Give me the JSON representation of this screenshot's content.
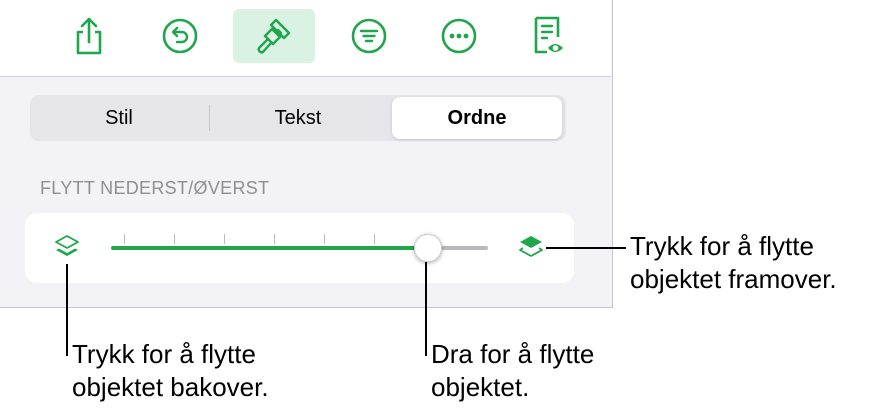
{
  "toolbar": {
    "buttons": [
      {
        "name": "share-icon",
        "active": false
      },
      {
        "name": "undo-icon",
        "active": false
      },
      {
        "name": "paintbrush-icon",
        "active": true
      },
      {
        "name": "filter-icon",
        "active": false
      },
      {
        "name": "more-icon",
        "active": false
      },
      {
        "name": "reader-view-icon",
        "active": false
      }
    ]
  },
  "tabs": {
    "items": [
      "Stil",
      "Tekst",
      "Ordne"
    ],
    "selected": "Ordne"
  },
  "arrange": {
    "section_title": "FLYTT NEDERST/ØVERST",
    "slider": {
      "value_fraction": 0.84,
      "tick_count": 7
    }
  },
  "callouts": {
    "back": {
      "line1": "Trykk for å flytte",
      "line2": "objektet bakover."
    },
    "drag": {
      "line1": "Dra for å flytte",
      "line2": "objektet."
    },
    "forward": {
      "line1": "Trykk for å flytte",
      "line2": "objektet framover."
    }
  },
  "colors": {
    "accent": "#1fa64a",
    "accent_bg": "#d9f2e3",
    "panel_bg": "#f2f2f7"
  }
}
